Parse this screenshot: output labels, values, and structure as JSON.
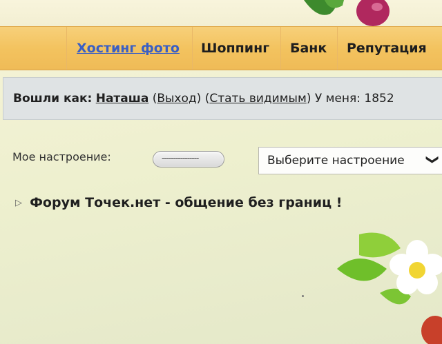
{
  "nav": {
    "items": [
      {
        "label": "Хостинг фото",
        "link": true
      },
      {
        "label": "Шоппинг",
        "link": false
      },
      {
        "label": "Банк",
        "link": false
      },
      {
        "label": "Репутация",
        "link": false
      }
    ]
  },
  "login": {
    "logged_in_as_label": "Вошли как:",
    "username": "Наташа",
    "open_paren_1": "(",
    "logout_link": "Выход",
    "close_paren_1": ")",
    "open_paren_2": "(",
    "visible_link": "Стать видимым",
    "close_paren_2": ")",
    "have_text": "У меня: 1852"
  },
  "mood": {
    "label": "Мое настроение:",
    "pill_value": "----------------",
    "select_value": "Выберите настроение",
    "select_chevron": "❯"
  },
  "forum": {
    "triangle": "▷",
    "title": "Форум Точек.нет - общение без границ !"
  },
  "colors": {
    "nav_bg": "#f3c35f",
    "link_blue": "#3a5fc4",
    "login_bar_bg": "#dfe3e4",
    "page_bg": "#eef0cf"
  }
}
